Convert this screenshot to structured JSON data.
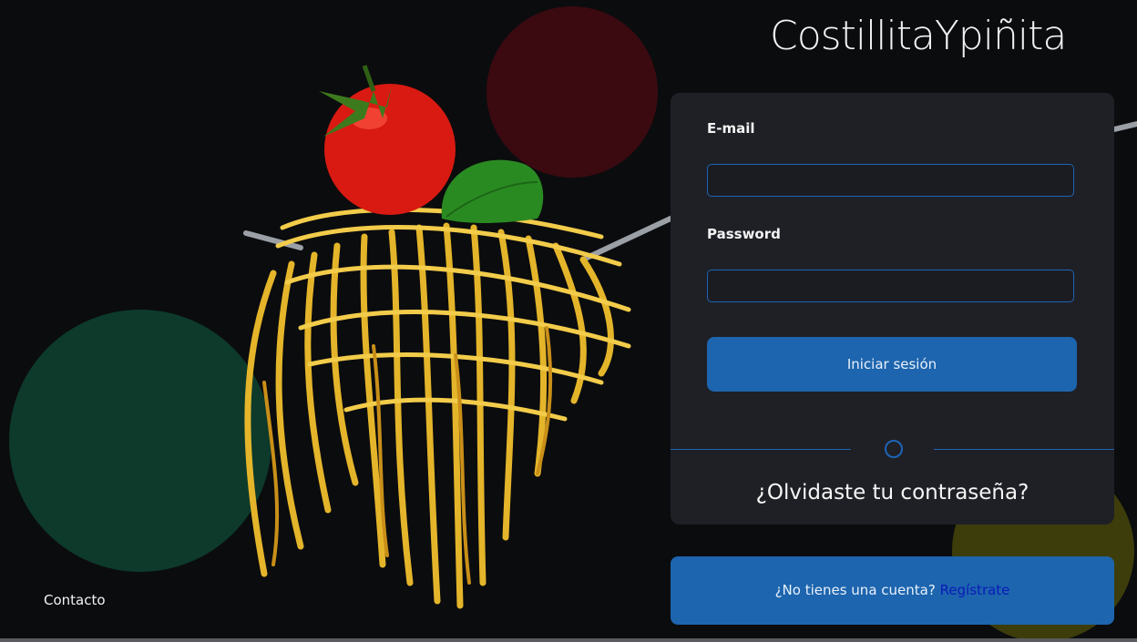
{
  "brand": {
    "name": "CostillitaYpiñita"
  },
  "login": {
    "email_label": "E-mail",
    "email_value": "",
    "password_label": "Password",
    "password_value": "",
    "submit_label": "Iniciar sesión",
    "forgot_label": "¿Olvidaste tu contraseña?"
  },
  "signup": {
    "prompt": "¿No tienes una cuenta?",
    "link_label": "Regístrate"
  },
  "footer": {
    "contact_label": "Contacto"
  },
  "colors": {
    "accent": "#1d65ae",
    "card_bg": "#1f2026",
    "link": "#0a1bb8",
    "circle_red": "#3a0a10",
    "circle_green": "#0d3a2b",
    "circle_olive": "#3d3d0c"
  },
  "icons": [
    "fork-icon",
    "tomato-icon",
    "basil-leaf-icon"
  ]
}
